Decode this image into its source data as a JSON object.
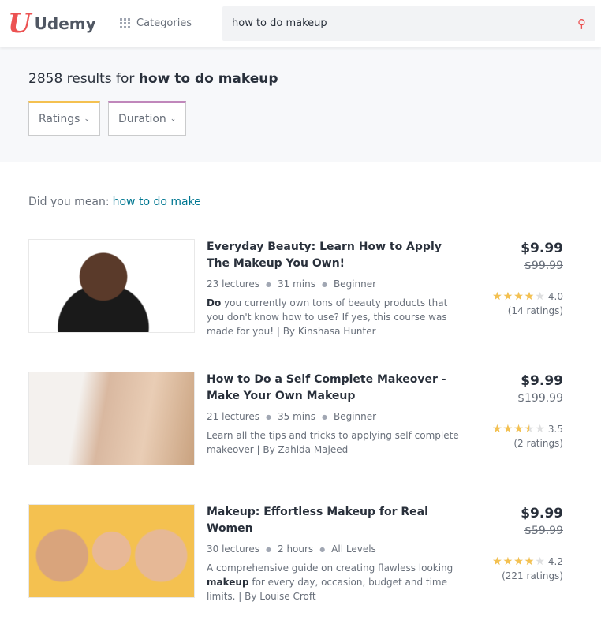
{
  "header": {
    "logo_mark": "U",
    "logo_text": "Udemy",
    "categories_label": "Categories",
    "search_value": "how to do makeup"
  },
  "results": {
    "count": "2858",
    "prefix": " results for ",
    "query": "how to do makeup"
  },
  "filters": [
    {
      "label": "Ratings",
      "accent": "#f4c150"
    },
    {
      "label": "Duration",
      "accent": "#c087bb"
    }
  ],
  "suggestion": {
    "label": "Did you mean:",
    "link": "how to do make"
  },
  "colors": {
    "brand": "#ec5252",
    "link": "#007791",
    "star": "#f4c150"
  },
  "courses": [
    {
      "title": "Everyday Beauty: Learn How to Apply The Makeup You Own!",
      "lectures": "23 lectures",
      "duration": "31 mins",
      "level": "Beginner",
      "desc_bold": "Do",
      "desc": " you currently own tons of beauty products that you don't know how to use? If yes, this course was made for you! | By Kinshasa Hunter",
      "price": "$9.99",
      "old_price": "$99.99",
      "rating": 4.0,
      "rating_text": "4.0",
      "ratings_count": "(14 ratings)",
      "thumb_alt": "smiling woman with bun hairstyle"
    },
    {
      "title": "How to Do a Self Complete Makeover - Make Your Own Makeup",
      "lectures": "21 lectures",
      "duration": "35 mins",
      "level": "Beginner",
      "desc_pre": "",
      "desc_bold": "",
      "desc": "Learn all the tips and tricks to applying self complete makeover | By Zahida Majeed",
      "price": "$9.99",
      "old_price": "$199.99",
      "rating": 3.5,
      "rating_text": "3.5",
      "ratings_count": "(2 ratings)",
      "thumb_alt": "makeup brushes and eyeshadow palette"
    },
    {
      "title": "Makeup: Effortless Makeup for Real Women",
      "lectures": "30 lectures",
      "duration": "2 hours",
      "level": "All Levels",
      "desc_pre": "A comprehensive guide on creating flawless looking ",
      "desc_bold": "makeup",
      "desc": " for every day, occasion, budget and time limits. | By Louise Croft",
      "price": "$9.99",
      "old_price": "$59.99",
      "rating": 4.2,
      "rating_text": "4.2",
      "ratings_count": "(221 ratings)",
      "thumb_alt": "three women faces on yellow background"
    }
  ]
}
